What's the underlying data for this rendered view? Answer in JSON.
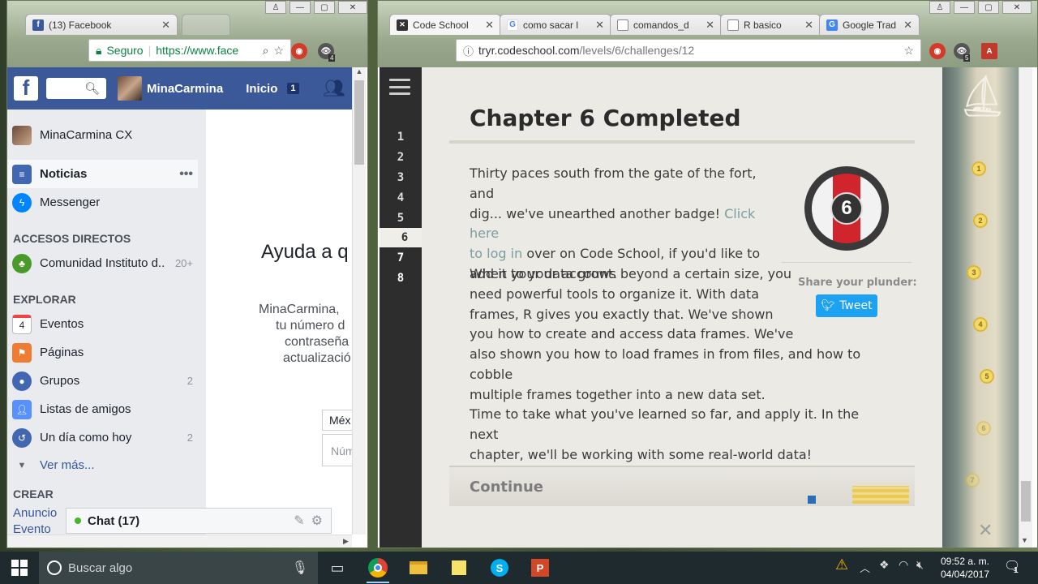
{
  "left_window": {
    "tab_title": "(13) Facebook",
    "secure_label": "Seguro",
    "url": "https://www.face",
    "ext_badge": "4"
  },
  "facebook": {
    "user_name": "MinaCarmina",
    "home_label": "Inicio",
    "home_count": "1",
    "profile_item": "MinaCarmina CX",
    "news_item": "Noticias",
    "messenger_item": "Messenger",
    "shortcuts_header": "ACCESOS DIRECTOS",
    "community_item": "Comunidad Instituto d..",
    "community_count": "20+",
    "explore_header": "EXPLORAR",
    "events_item": "Eventos",
    "events_day": "4",
    "pages_item": "Páginas",
    "groups_item": "Grupos",
    "groups_count": "2",
    "friends_item": "Listas de amigos",
    "memories_item": "Un día como hoy",
    "memories_count": "2",
    "more_item": "Ver más...",
    "create_header": "CREAR",
    "create_ad": "Anuncio",
    "create_event": "Evento",
    "main_heading": "Ayuda a q",
    "main_text_1": "MinaCarmina,",
    "main_text_2": "tu número d",
    "main_text_3": "contraseña",
    "main_text_4": "actualizació",
    "country_select": "Méx",
    "number_placeholder": "Núm",
    "chat_label": "Chat (17)"
  },
  "right_window": {
    "tabs": [
      {
        "title": "Code School",
        "favicon": "CS"
      },
      {
        "title": "como sacar l",
        "favicon": "G"
      },
      {
        "title": "comandos_d",
        "favicon": "doc"
      },
      {
        "title": "R basico",
        "favicon": "doc"
      },
      {
        "title": "Google Trad",
        "favicon": "GT"
      }
    ],
    "url_domain": "tryr.codeschool.com",
    "url_path": "/levels/6/challenges/12",
    "ext_badge": "5"
  },
  "codeschool": {
    "levels": [
      "1",
      "2",
      "3",
      "4",
      "5",
      "6",
      "7",
      "8"
    ],
    "current_level": "6",
    "chapter_title": "Chapter 6 Completed",
    "p1_a": "Thirty paces south from the gate of the fort, and",
    "p1_b": "dig... we've unearthed another badge!",
    "p1_link_a": "Click here",
    "p1_link_b": "to log in",
    "p1_c": "over on Code School, if you'd like to",
    "p1_d": "add it to your account.",
    "p2_lines": [
      "When your data grows beyond a certain size, you",
      "need powerful tools to organize it. With data",
      "frames, R gives you exactly that. We've shown",
      "you how to create and access data frames. We've",
      "also shown you how to load frames in from files, and how to cobble",
      "multiple frames together into a new data set."
    ],
    "p3_lines": [
      "Time to take what you've learned so far, and apply it. In the next",
      "chapter, we'll be working with some real-world data!"
    ],
    "badge_number": "6",
    "share_label": "Share your plunder:",
    "tweet_label": "Tweet",
    "continue_label": "Continue",
    "map_markers": [
      "1",
      "2",
      "3",
      "4",
      "5",
      "6",
      "7"
    ]
  },
  "taskbar": {
    "search_placeholder": "Buscar algo",
    "time": "09:52 a. m.",
    "date": "04/04/2017",
    "notif_count": "1"
  }
}
